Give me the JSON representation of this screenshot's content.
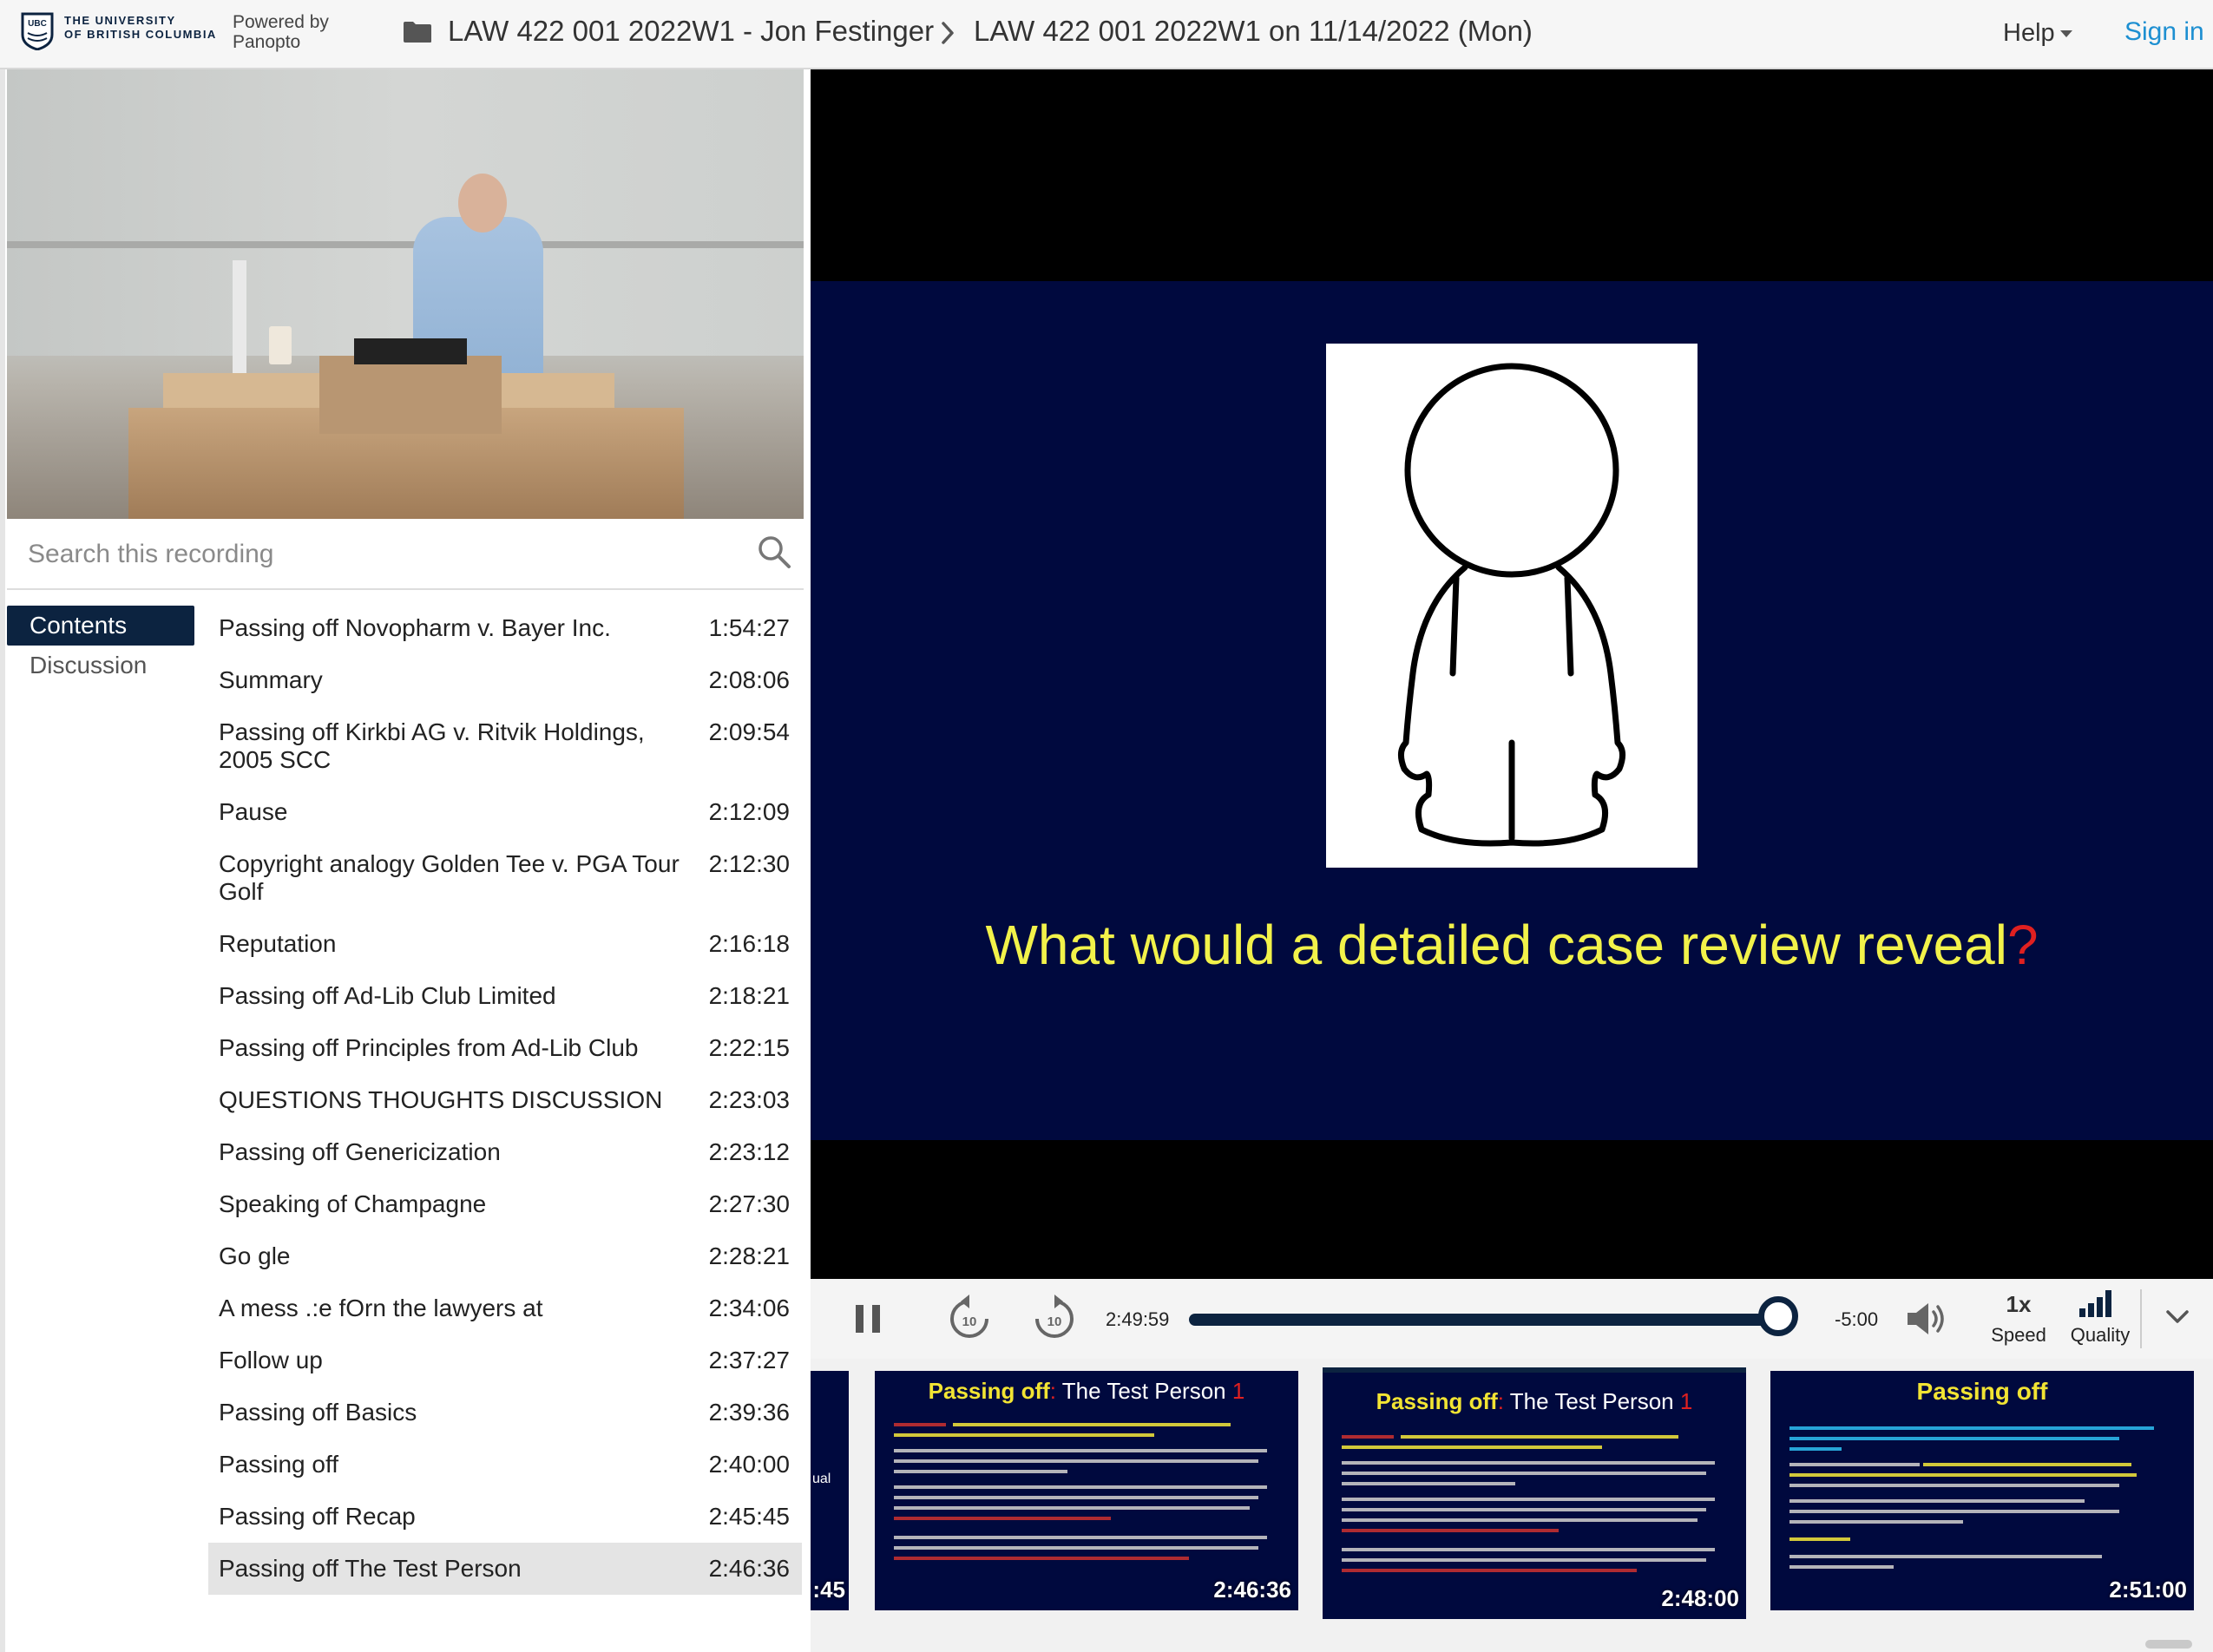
{
  "header": {
    "logo_lines": [
      "THE UNIVERSITY",
      "OF BRITISH COLUMBIA"
    ],
    "powered_by": [
      "Powered by",
      "Panopto"
    ],
    "breadcrumb": [
      "LAW 422 001 2022W1 - Jon Festinger",
      "LAW 422 001 2022W1 on 11/14/2022 (Mon)"
    ],
    "help_label": "Help",
    "signin_label": "Sign in"
  },
  "search": {
    "placeholder": "Search this recording"
  },
  "tabs": [
    "Contents",
    "Discussion"
  ],
  "contents": [
    {
      "title": "Passing off Novopharm v. Bayer Inc.",
      "time": "1:54:27"
    },
    {
      "title": "Summary",
      "time": "2:08:06"
    },
    {
      "title": "Passing off Kirkbi AG v. Ritvik Holdings, 2005 SCC",
      "time": "2:09:54"
    },
    {
      "title": "Pause",
      "time": "2:12:09"
    },
    {
      "title": "Copyright analogy Golden Tee v. PGA Tour Golf",
      "time": "2:12:30"
    },
    {
      "title": "Reputation",
      "time": "2:16:18"
    },
    {
      "title": "Passing off Ad-Lib Club Limited",
      "time": "2:18:21"
    },
    {
      "title": "Passing off Principles from Ad-Lib Club",
      "time": "2:22:15"
    },
    {
      "title": "QUESTIONS THOUGHTS DISCUSSION",
      "time": "2:23:03"
    },
    {
      "title": "Passing off Genericization",
      "time": "2:23:12"
    },
    {
      "title": "Speaking of Champagne",
      "time": "2:27:30"
    },
    {
      "title": "Go gle",
      "time": "2:28:21"
    },
    {
      "title": "A mess .:e fOrn the lawyers at",
      "time": "2:34:06"
    },
    {
      "title": "Follow up",
      "time": "2:37:27"
    },
    {
      "title": "Passing off Basics",
      "time": "2:39:36"
    },
    {
      "title": "Passing off",
      "time": "2:40:00"
    },
    {
      "title": "Passing off Recap",
      "time": "2:45:45"
    },
    {
      "title": "Passing off The Test Person",
      "time": "2:46:36"
    }
  ],
  "slide": {
    "caption": "What would a detailed case review reveal",
    "caption_mark": "?"
  },
  "player": {
    "current_time": "2:49:59",
    "remaining": "-5:00",
    "progress_fraction": 0.97,
    "speed_value": "1x",
    "speed_label": "Speed",
    "quality_label": "Quality"
  },
  "thumbnails": [
    {
      "time": ":45",
      "fragment": "ual"
    },
    {
      "title_main": "Passing off",
      "title_colon": ":",
      "title_rest": " The Test Person",
      "title_num": " 1",
      "time": "2:46:36"
    },
    {
      "title_main": "Passing off",
      "title_colon": ":",
      "title_rest": " The Test Person",
      "title_num": " 1",
      "time": "2:48:00"
    },
    {
      "title_main": "Passing off",
      "time": "2:51:00"
    }
  ],
  "colors": {
    "brand_navy": "#0c2340",
    "link_blue": "#1d8fd1",
    "slide_bg": "#00093e",
    "slide_text": "#f2f24a"
  }
}
